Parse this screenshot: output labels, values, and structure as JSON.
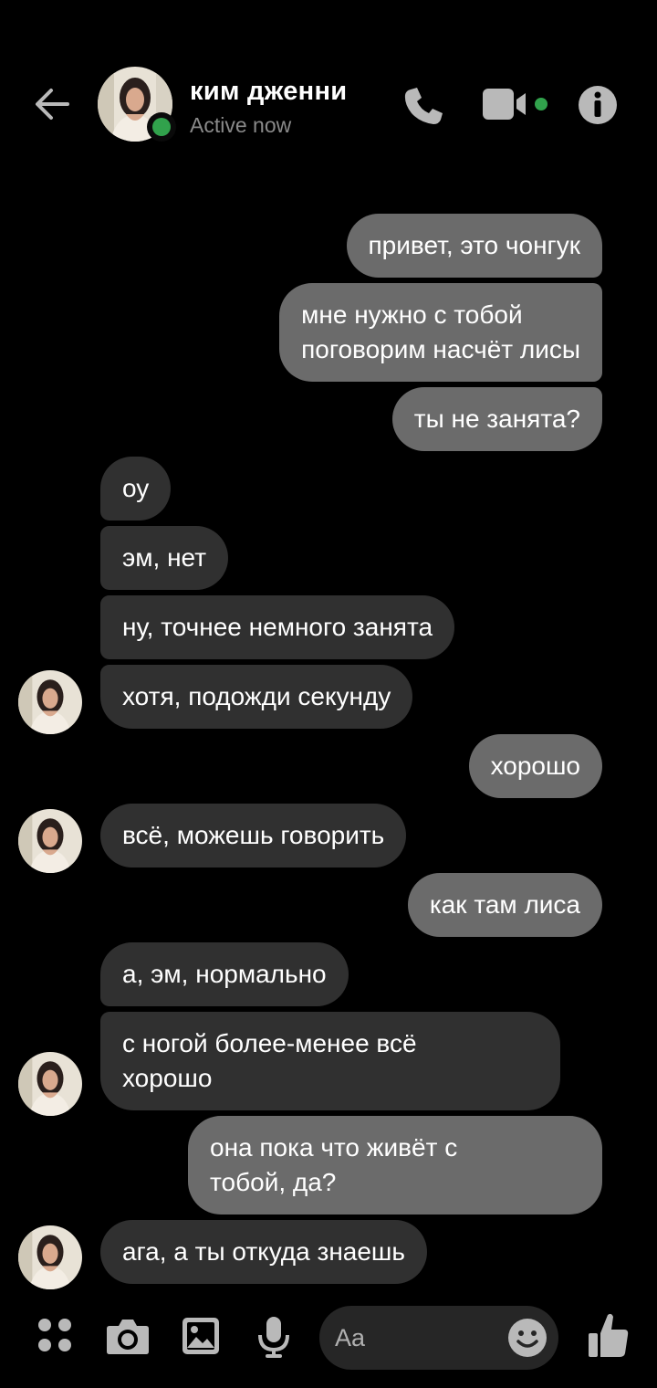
{
  "header": {
    "name": "ким дженни",
    "status": "Active now"
  },
  "messages": [
    {
      "side": "out",
      "text": "привет, это чонгук"
    },
    {
      "side": "out",
      "text": "мне нужно с тобой\nпоговорим насчёт лисы"
    },
    {
      "side": "out",
      "text": "ты не занята?"
    },
    {
      "side": "in",
      "text": "оу"
    },
    {
      "side": "in",
      "text": "эм, нет"
    },
    {
      "side": "in",
      "text": "ну, точнее немного занята"
    },
    {
      "side": "in",
      "text": "хотя, подожди секунду"
    },
    {
      "side": "out",
      "text": "хорошо"
    },
    {
      "side": "in",
      "text": "всё, можешь говорить"
    },
    {
      "side": "out",
      "text": "как там лиса"
    },
    {
      "side": "in",
      "text": "а, эм, нормально"
    },
    {
      "side": "in",
      "text": "с ногой более-менее всё\nхорошо"
    },
    {
      "side": "out",
      "text": "она пока что живёт с\nтобой, да?"
    },
    {
      "side": "in",
      "text": "ага, а ты откуда знаешь"
    }
  ],
  "composer": {
    "placeholder": "Aa"
  },
  "colors": {
    "accent": "#31a24c",
    "outgoing_bubble": "#6b6b6b",
    "incoming_bubble": "#303030",
    "icon": "#b9b9b9"
  },
  "icons": [
    "back-arrow-icon",
    "phone-icon",
    "video-camera-icon",
    "info-icon",
    "menu-dots-icon",
    "camera-icon",
    "image-icon",
    "microphone-icon",
    "emoji-icon",
    "thumbs-up-icon"
  ]
}
